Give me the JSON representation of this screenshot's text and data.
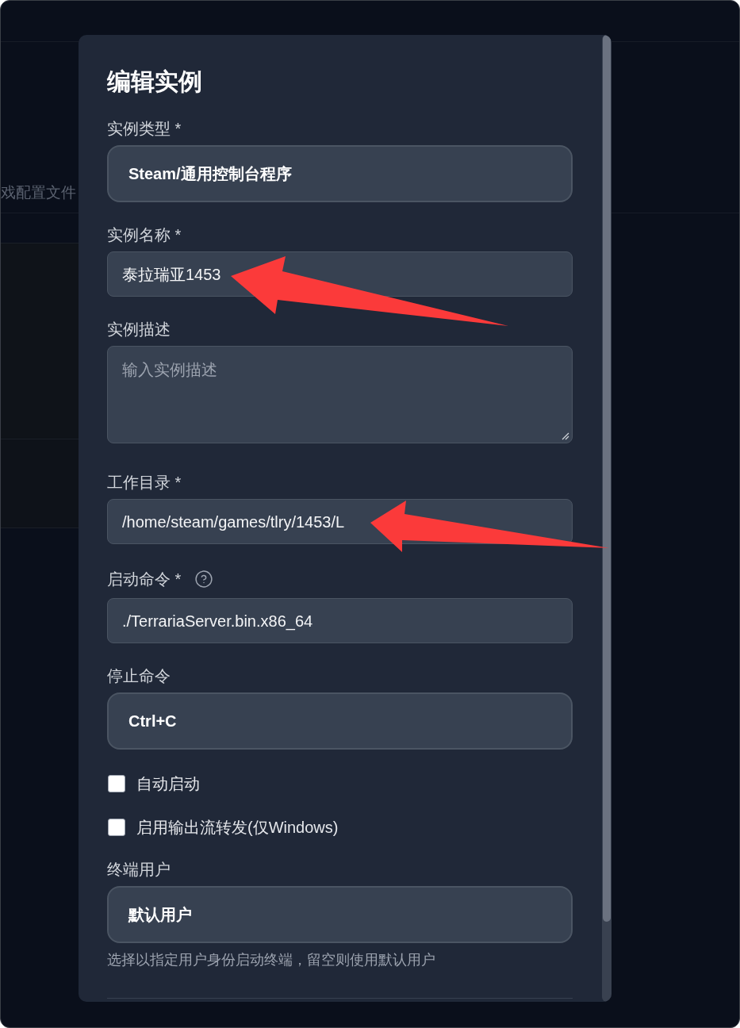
{
  "background": {
    "partial_label": "戏配置文件"
  },
  "dialog": {
    "title": "编辑实例",
    "fields": [
      {
        "kind": "select",
        "label": "实例类型 *",
        "value": "Steam/通用控制台程序"
      },
      {
        "kind": "input",
        "label": "实例名称 *",
        "value": "泰拉瑞亚1453"
      },
      {
        "kind": "textarea",
        "label": "实例描述",
        "placeholder": "输入实例描述"
      },
      {
        "kind": "input",
        "label": "工作目录 *",
        "value": "/home/steam/games/tlry/1453/L"
      },
      {
        "kind": "input",
        "label": "启动命令 *",
        "help": true,
        "value": "./TerrariaServer.bin.x86_64"
      },
      {
        "kind": "select",
        "label": "停止命令",
        "value": "Ctrl+C"
      },
      {
        "kind": "checkbox",
        "label": "自动启动",
        "checked": false
      },
      {
        "kind": "checkbox",
        "label": "启用输出流转发(仅Windows)",
        "checked": false
      },
      {
        "kind": "select",
        "label": "终端用户",
        "value": "默认用户",
        "hint": "选择以指定用户身份启动终端，留空则使用默认用户"
      }
    ]
  },
  "annotations": [
    {
      "kind": "arrow"
    },
    {
      "kind": "arrow"
    }
  ]
}
